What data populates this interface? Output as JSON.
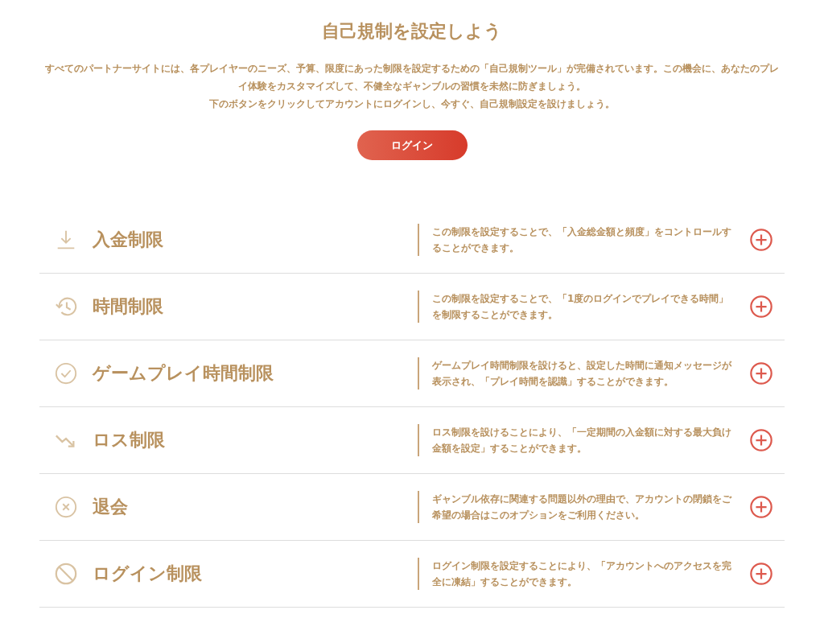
{
  "title": "自己規制を設定しよう",
  "intro": [
    "すべてのパートナーサイトには、各プレイヤーのニーズ、予算、限度にあった制限を設定するための「自己規制ツール」が完備されています。この機会に、あなたのプレイ体験をカスタマイズして、不健全なギャンブルの習慣を未然に防ぎましょう。",
    "下のボタンをクリックしてアカウントにログインし、今すぐ、自己規制設定を設けましょう。"
  ],
  "login_button": "ログイン",
  "limits": [
    {
      "kind": "download",
      "title": "入金制限",
      "description": "この制限を設定することで、「入金総金額と頻度」をコントロールすることができます。"
    },
    {
      "kind": "history",
      "title": "時間制限",
      "description": "この制限を設定することで、「1度のログインでプレイできる時間」を制限することができます。"
    },
    {
      "kind": "check",
      "title": "ゲームプレイ時間制限",
      "description": "ゲームプレイ時間制限を設けると、設定した時間に通知メッセージが表示され、「プレイ時間を認識」することができます。"
    },
    {
      "kind": "trend",
      "title": "ロス制限",
      "description": "ロス制限を設けることにより、「一定期間の入金額に対する最大負け金額を設定」することができます。"
    },
    {
      "kind": "close",
      "title": "退会",
      "description": "ギャンブル依存に関連する問題以外の理由で、アカウントの閉鎖をご希望の場合はこのオプションをご利用ください。"
    },
    {
      "kind": "ban",
      "title": "ログイン制限",
      "description": "ログイン制限を設定することにより、「アカウントへのアクセスを完全に凍結」することができます。"
    }
  ]
}
